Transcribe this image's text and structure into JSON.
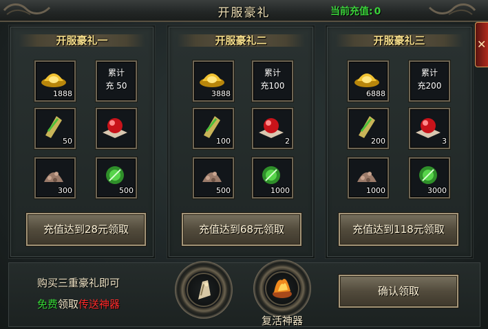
{
  "header": {
    "title": "开服豪礼",
    "recharge_label": "当前充值:",
    "recharge_value": "0"
  },
  "colors": {
    "gold_text": "#f5dd8a",
    "green": "#36d636",
    "red": "#ff2b2b"
  },
  "packs": [
    {
      "title": "开服豪礼一",
      "items": [
        {
          "icon": "gold-ingot-icon",
          "count": "1888"
        },
        {
          "icon": "text-slot",
          "line1": "累计",
          "line2": "充 50"
        },
        {
          "icon": "scroll-icon",
          "count": "50"
        },
        {
          "icon": "red-orb-icon",
          "count": ""
        },
        {
          "icon": "ore-icon",
          "count": "300"
        },
        {
          "icon": "green-orb-icon",
          "count": "500"
        }
      ],
      "button": "充值达到28元领取"
    },
    {
      "title": "开服豪礼二",
      "items": [
        {
          "icon": "gold-ingot-icon",
          "count": "3888"
        },
        {
          "icon": "text-slot",
          "line1": "累计",
          "line2": "充100"
        },
        {
          "icon": "scroll-icon",
          "count": "100"
        },
        {
          "icon": "red-orb-icon",
          "count": "2"
        },
        {
          "icon": "ore-icon",
          "count": "500"
        },
        {
          "icon": "green-orb-icon",
          "count": "1000"
        }
      ],
      "button": "充值达到68元领取"
    },
    {
      "title": "开服豪礼三",
      "items": [
        {
          "icon": "gold-ingot-icon",
          "count": "6888"
        },
        {
          "icon": "text-slot",
          "line1": "累计",
          "line2": "充200"
        },
        {
          "icon": "scroll-icon",
          "count": "200"
        },
        {
          "icon": "red-orb-icon",
          "count": "3"
        },
        {
          "icon": "ore-icon",
          "count": "1000"
        },
        {
          "icon": "green-orb-icon",
          "count": "3000"
        }
      ],
      "button": "充值达到118元领取"
    }
  ],
  "bottom": {
    "promo_line1": "购买三重豪礼即可",
    "promo_free": "免费",
    "promo_claim": "领取",
    "promo_item": "传送神器",
    "artifact1_icon": "teleport-stone-icon",
    "artifact2_icon": "revive-flame-icon",
    "artifact2_label": "复活神器",
    "confirm_button": "确认领取"
  }
}
